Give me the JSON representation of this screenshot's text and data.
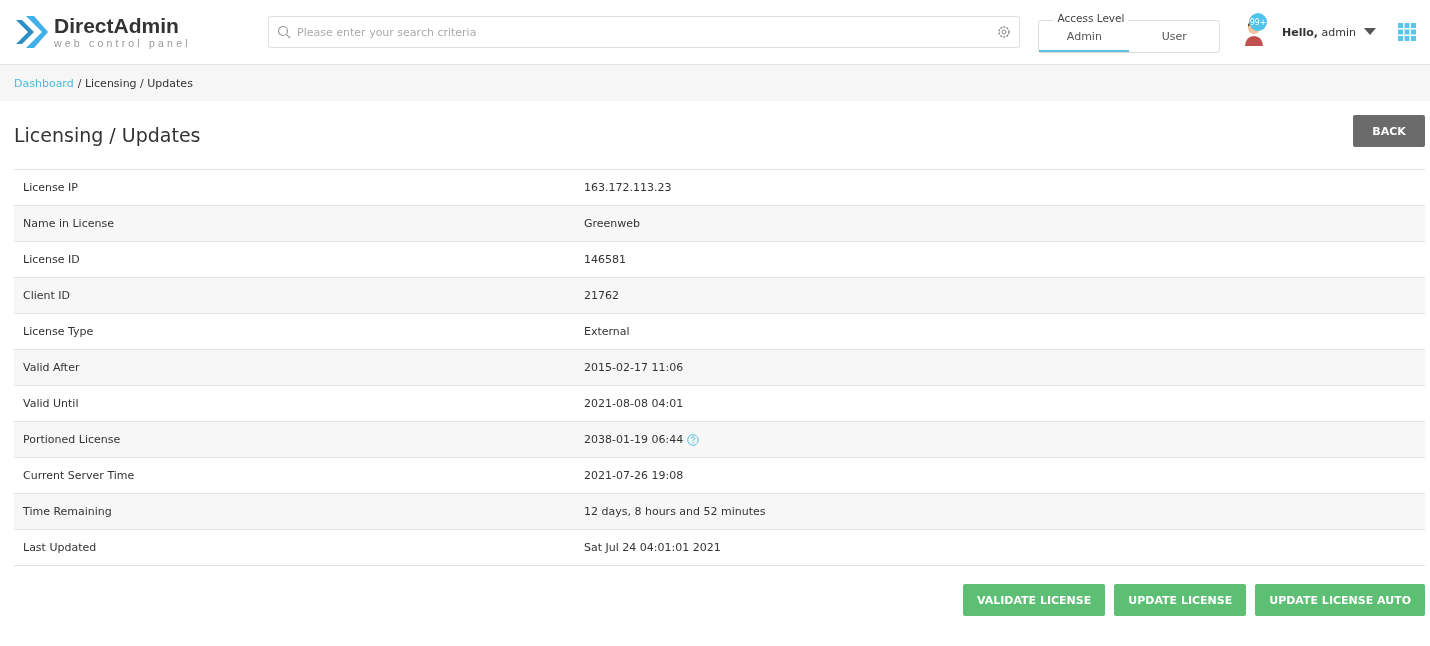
{
  "logo": {
    "name": "DirectAdmin",
    "tagline": "web control panel"
  },
  "search": {
    "placeholder": "Please enter your search criteria"
  },
  "access_level": {
    "label": "Access Level",
    "options": [
      {
        "label": "Admin",
        "selected": true
      },
      {
        "label": "User",
        "selected": false
      }
    ]
  },
  "user": {
    "badge": "99+",
    "greeting": "**Hello,** admin"
  },
  "breadcrumb": [
    {
      "label": "Dashboard",
      "kind": "link"
    },
    {
      "label": "/ Licensing / Updates",
      "kind": "current"
    }
  ],
  "page_title": "Licensing / Updates",
  "back_button": "BACK",
  "rows": [
    {
      "label": "License IP",
      "value": "163.172.113.23",
      "help": false
    },
    {
      "label": "Name in License",
      "value": "Greenweb",
      "help": false
    },
    {
      "label": "License ID",
      "value": "146581",
      "help": false
    },
    {
      "label": "Client ID",
      "value": "21762",
      "help": false
    },
    {
      "label": "License Type",
      "value": "External",
      "help": false
    },
    {
      "label": "Valid After",
      "value": "2015-02-17 11:06",
      "help": false
    },
    {
      "label": "Valid Until",
      "value": "2021-08-08 04:01",
      "help": false
    },
    {
      "label": "Portioned License",
      "value": "2038-01-19 06:44",
      "help": true
    },
    {
      "label": "Current Server Time",
      "value": "2021-07-26 19:08",
      "help": false
    },
    {
      "label": "Time Remaining",
      "value": "12 days, 8 hours and 52 minutes",
      "help": false
    },
    {
      "label": "Last Updated",
      "value": "Sat Jul 24 04:01:01 2021",
      "help": false
    }
  ],
  "actions": [
    "VALIDATE LICENSE",
    "UPDATE LICENSE",
    "UPDATE LICENSE AUTO"
  ]
}
